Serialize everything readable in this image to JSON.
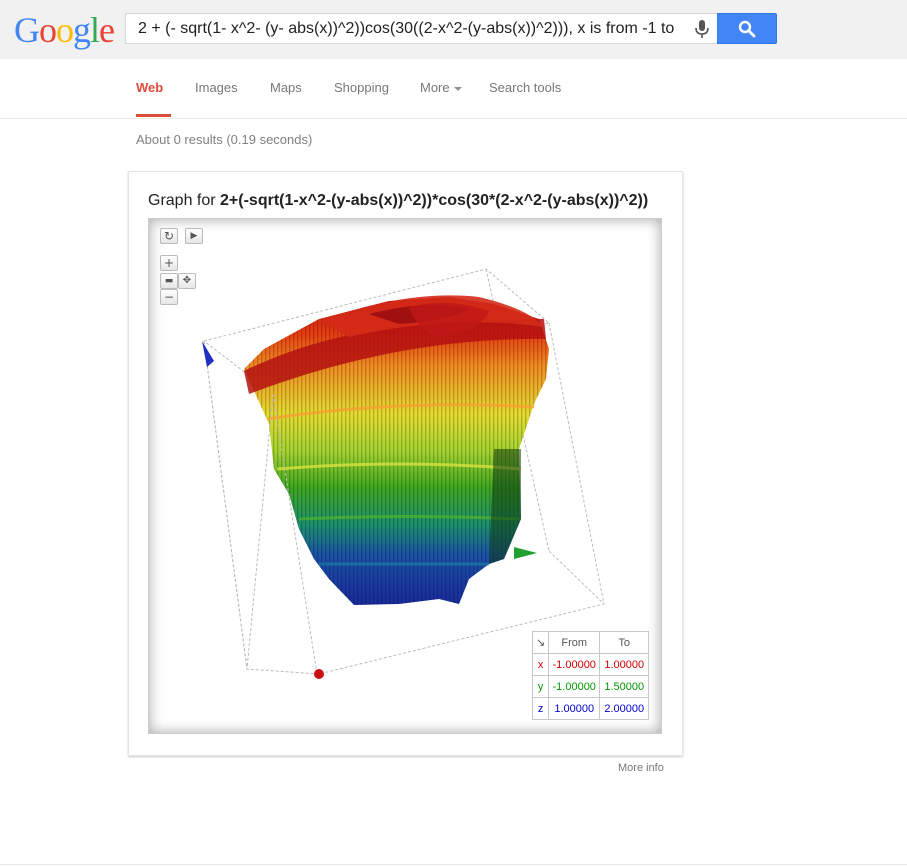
{
  "header": {
    "logo_letters": [
      {
        "ch": "G",
        "color": "#4285f4"
      },
      {
        "ch": "o",
        "color": "#ea4335"
      },
      {
        "ch": "o",
        "color": "#fbbc05"
      },
      {
        "ch": "g",
        "color": "#4285f4"
      },
      {
        "ch": "l",
        "color": "#34a853"
      },
      {
        "ch": "e",
        "color": "#ea4335"
      }
    ],
    "search_query": "2 + (- sqrt(1- x^2- (y- abs(x))^2))cos(30((2-x^2-(y-abs(x))^2))), x is from -1 to",
    "mic_icon": "microphone-icon",
    "search_icon": "magnifier-icon",
    "accent": "#4285f4"
  },
  "tabs": {
    "items": [
      "Web",
      "Images",
      "Maps",
      "Shopping",
      "More",
      "Search tools"
    ],
    "active": "Web",
    "active_color": "#dd4b39"
  },
  "results": {
    "stats": "About 0 results (0.19 seconds)"
  },
  "graph": {
    "title_prefix": "Graph for ",
    "title_formula": "2+(-sqrt(1-x^2-(y-abs(x))^2))*cos(30*(2-x^2-(y-abs(x))^2))",
    "controls": {
      "reset": "↻",
      "play": "▶",
      "zoom_in": "+",
      "zoom_out": "−"
    },
    "range_table": {
      "corner_icon": "↘",
      "headers": [
        "From",
        "To"
      ],
      "rows": [
        {
          "var": "x",
          "from": "-1.00000",
          "to": "1.00000",
          "color": "#cc0000"
        },
        {
          "var": "y",
          "from": "-1.00000",
          "to": "1.50000",
          "color": "#009900"
        },
        {
          "var": "z",
          "from": "1.00000",
          "to": "2.00000",
          "color": "#0000cc"
        }
      ]
    }
  },
  "footer": {
    "more_info": "More info"
  }
}
